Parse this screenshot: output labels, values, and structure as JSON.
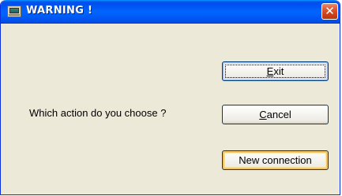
{
  "window": {
    "title": "WARNING !",
    "close_glyph": "✕"
  },
  "dialog": {
    "prompt": "Which action do you choose ?",
    "buttons": {
      "exit": {
        "mnemonic": "E",
        "rest": "xit"
      },
      "cancel": {
        "mnemonic": "C",
        "rest": "ancel"
      },
      "new_connection": {
        "label": "New connection"
      }
    }
  },
  "colors": {
    "titlebar": "#0058ee",
    "dialog_bg": "#ece9d8",
    "close_button": "#d4522e",
    "focus_highlight": "#f7c35b"
  },
  "icons": {
    "app": "monitor-icon",
    "close": "close-icon"
  }
}
